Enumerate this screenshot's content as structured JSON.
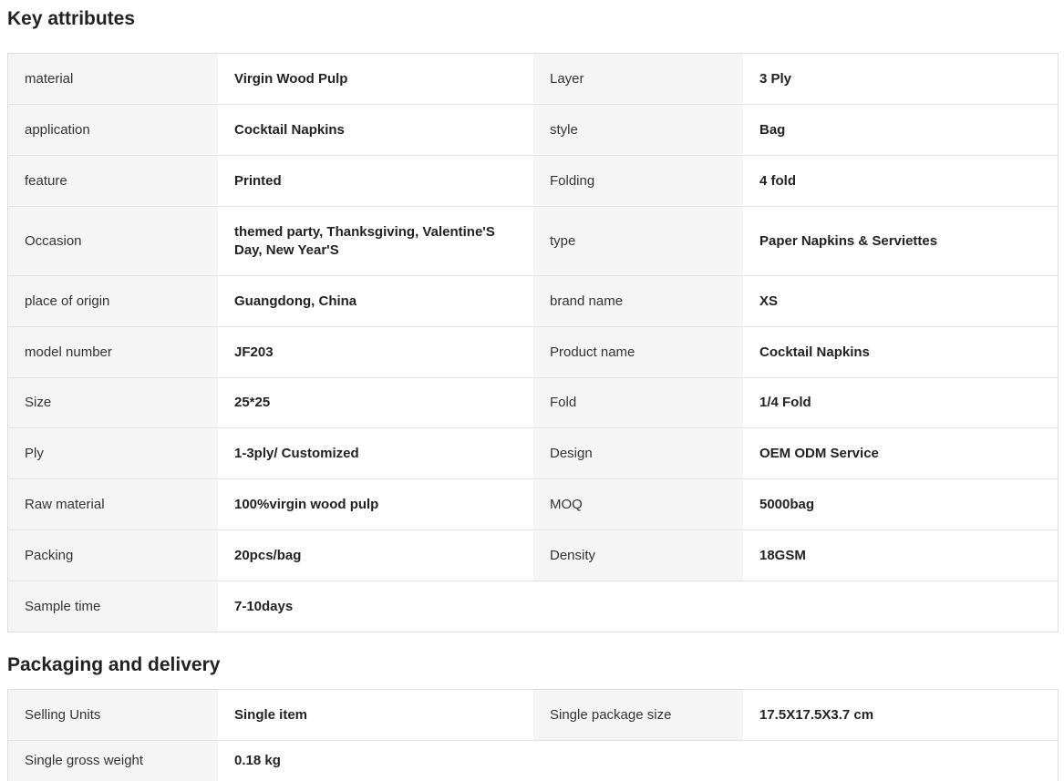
{
  "sections": [
    {
      "title": "Key attributes",
      "rows": [
        [
          [
            "material",
            "Virgin Wood Pulp"
          ],
          [
            "Layer",
            "3 Ply"
          ]
        ],
        [
          [
            "application",
            "Cocktail Napkins"
          ],
          [
            "style",
            "Bag"
          ]
        ],
        [
          [
            "feature",
            "Printed"
          ],
          [
            "Folding",
            "4 fold"
          ]
        ],
        [
          [
            "Occasion",
            "themed party, Thanksgiving, Valentine'S Day, New Year'S"
          ],
          [
            "type",
            "Paper Napkins & Serviettes"
          ]
        ],
        [
          [
            "place of origin",
            "Guangdong, China"
          ],
          [
            "brand name",
            "XS"
          ]
        ],
        [
          [
            "model number",
            "JF203"
          ],
          [
            "Product name",
            "Cocktail Napkins"
          ]
        ],
        [
          [
            "Size",
            "25*25"
          ],
          [
            "Fold",
            "1/4 Fold"
          ]
        ],
        [
          [
            "Ply",
            "1-3ply/ Customized"
          ],
          [
            "Design",
            "OEM ODM Service"
          ]
        ],
        [
          [
            "Raw material",
            "100%virgin wood pulp"
          ],
          [
            "MOQ",
            "5000bag"
          ]
        ],
        [
          [
            "Packing",
            "20pcs/bag"
          ],
          [
            "Density",
            "18GSM"
          ]
        ],
        [
          [
            "Sample time",
            "7-10days"
          ]
        ]
      ]
    },
    {
      "title": "Packaging and delivery",
      "rows": [
        [
          [
            "Selling Units",
            "Single item"
          ],
          [
            "Single package size",
            "17.5X17.5X3.7 cm"
          ]
        ],
        [
          [
            "Single gross weight",
            "0.18 kg"
          ]
        ]
      ]
    }
  ]
}
